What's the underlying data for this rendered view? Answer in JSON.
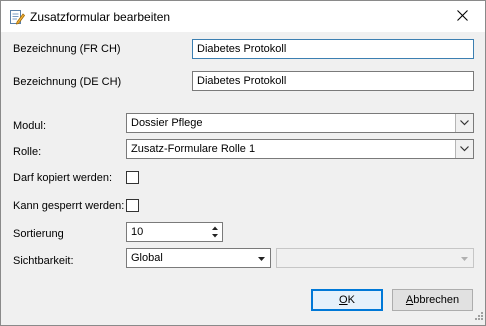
{
  "window": {
    "title": "Zusatzformular bearbeiten",
    "icon": "edit-form-icon",
    "close_icon": "close-icon"
  },
  "form": {
    "bezeichnung_fr": {
      "label": "Bezeichnung (FR CH)",
      "value": "Diabetes Protokoll"
    },
    "bezeichnung_de": {
      "label": "Bezeichnung (DE CH)",
      "value": "Diabetes Protokoll"
    },
    "modul": {
      "label": "Modul:",
      "value": "Dossier Pflege"
    },
    "rolle": {
      "label": "Rolle:",
      "value": "Zusatz-Formulare Rolle 1"
    },
    "darf_kopiert": {
      "label": "Darf kopiert werden:",
      "checked": false
    },
    "kann_gesperrt": {
      "label": "Kann gesperrt werden:",
      "checked": false
    },
    "sortierung": {
      "label": "Sortierung",
      "value": "10"
    },
    "sichtbarkeit": {
      "label": "Sichtbarkeit:",
      "value": "Global",
      "secondary_value": ""
    }
  },
  "buttons": {
    "ok": {
      "accel": "O",
      "rest": "K"
    },
    "cancel": {
      "accel": "A",
      "rest": "bbrechen"
    }
  },
  "colors": {
    "window_bg": "#f0f0f0",
    "titlebar_bg": "#ffffff",
    "focus_border": "#3c7fb1",
    "default_button_border": "#0078d7"
  }
}
